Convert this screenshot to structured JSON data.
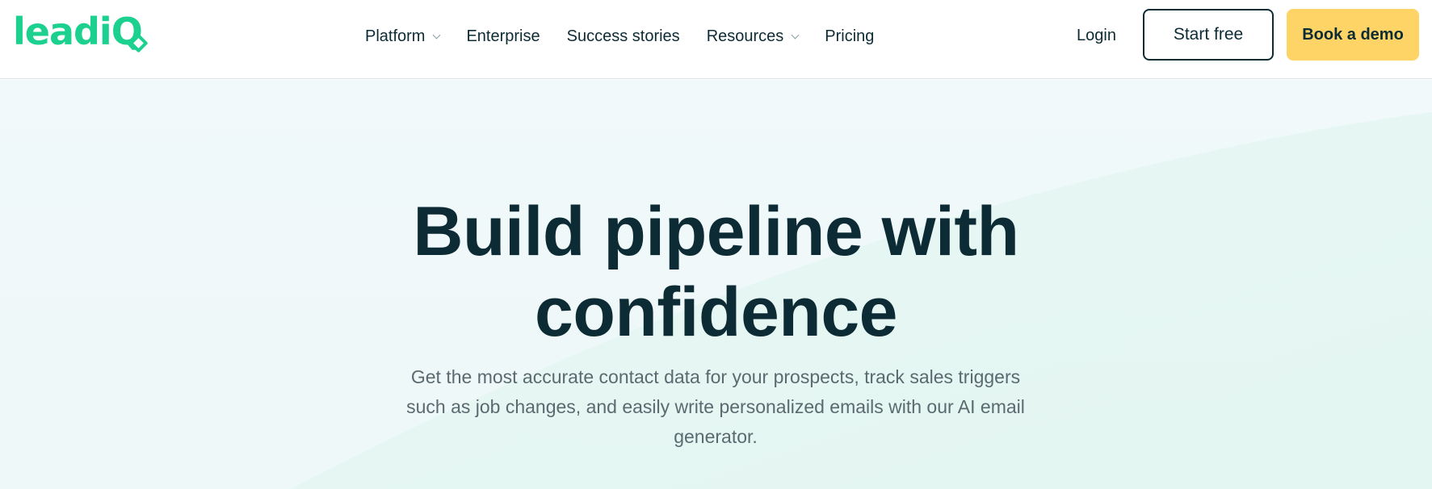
{
  "brand": {
    "logo_text": "leadi",
    "logo_q": "Q",
    "accent": "#1cd18f"
  },
  "nav": {
    "items": [
      {
        "label": "Platform",
        "has_dropdown": true
      },
      {
        "label": "Enterprise",
        "has_dropdown": false
      },
      {
        "label": "Success stories",
        "has_dropdown": false
      },
      {
        "label": "Resources",
        "has_dropdown": true
      },
      {
        "label": "Pricing",
        "has_dropdown": false
      }
    ],
    "login_label": "Login",
    "start_label": "Start free",
    "demo_label": "Book a demo"
  },
  "hero": {
    "title_line1": "Build pipeline with",
    "title_line2": "confidence",
    "subtitle": "Get the most accurate contact data for your prospects, track sales triggers such as job changes, and easily write personalized emails with our AI email generator."
  },
  "colors": {
    "primary_text": "#0c2b35",
    "demo_button": "#ffd466",
    "hero_bg": "#f1f9fa"
  }
}
